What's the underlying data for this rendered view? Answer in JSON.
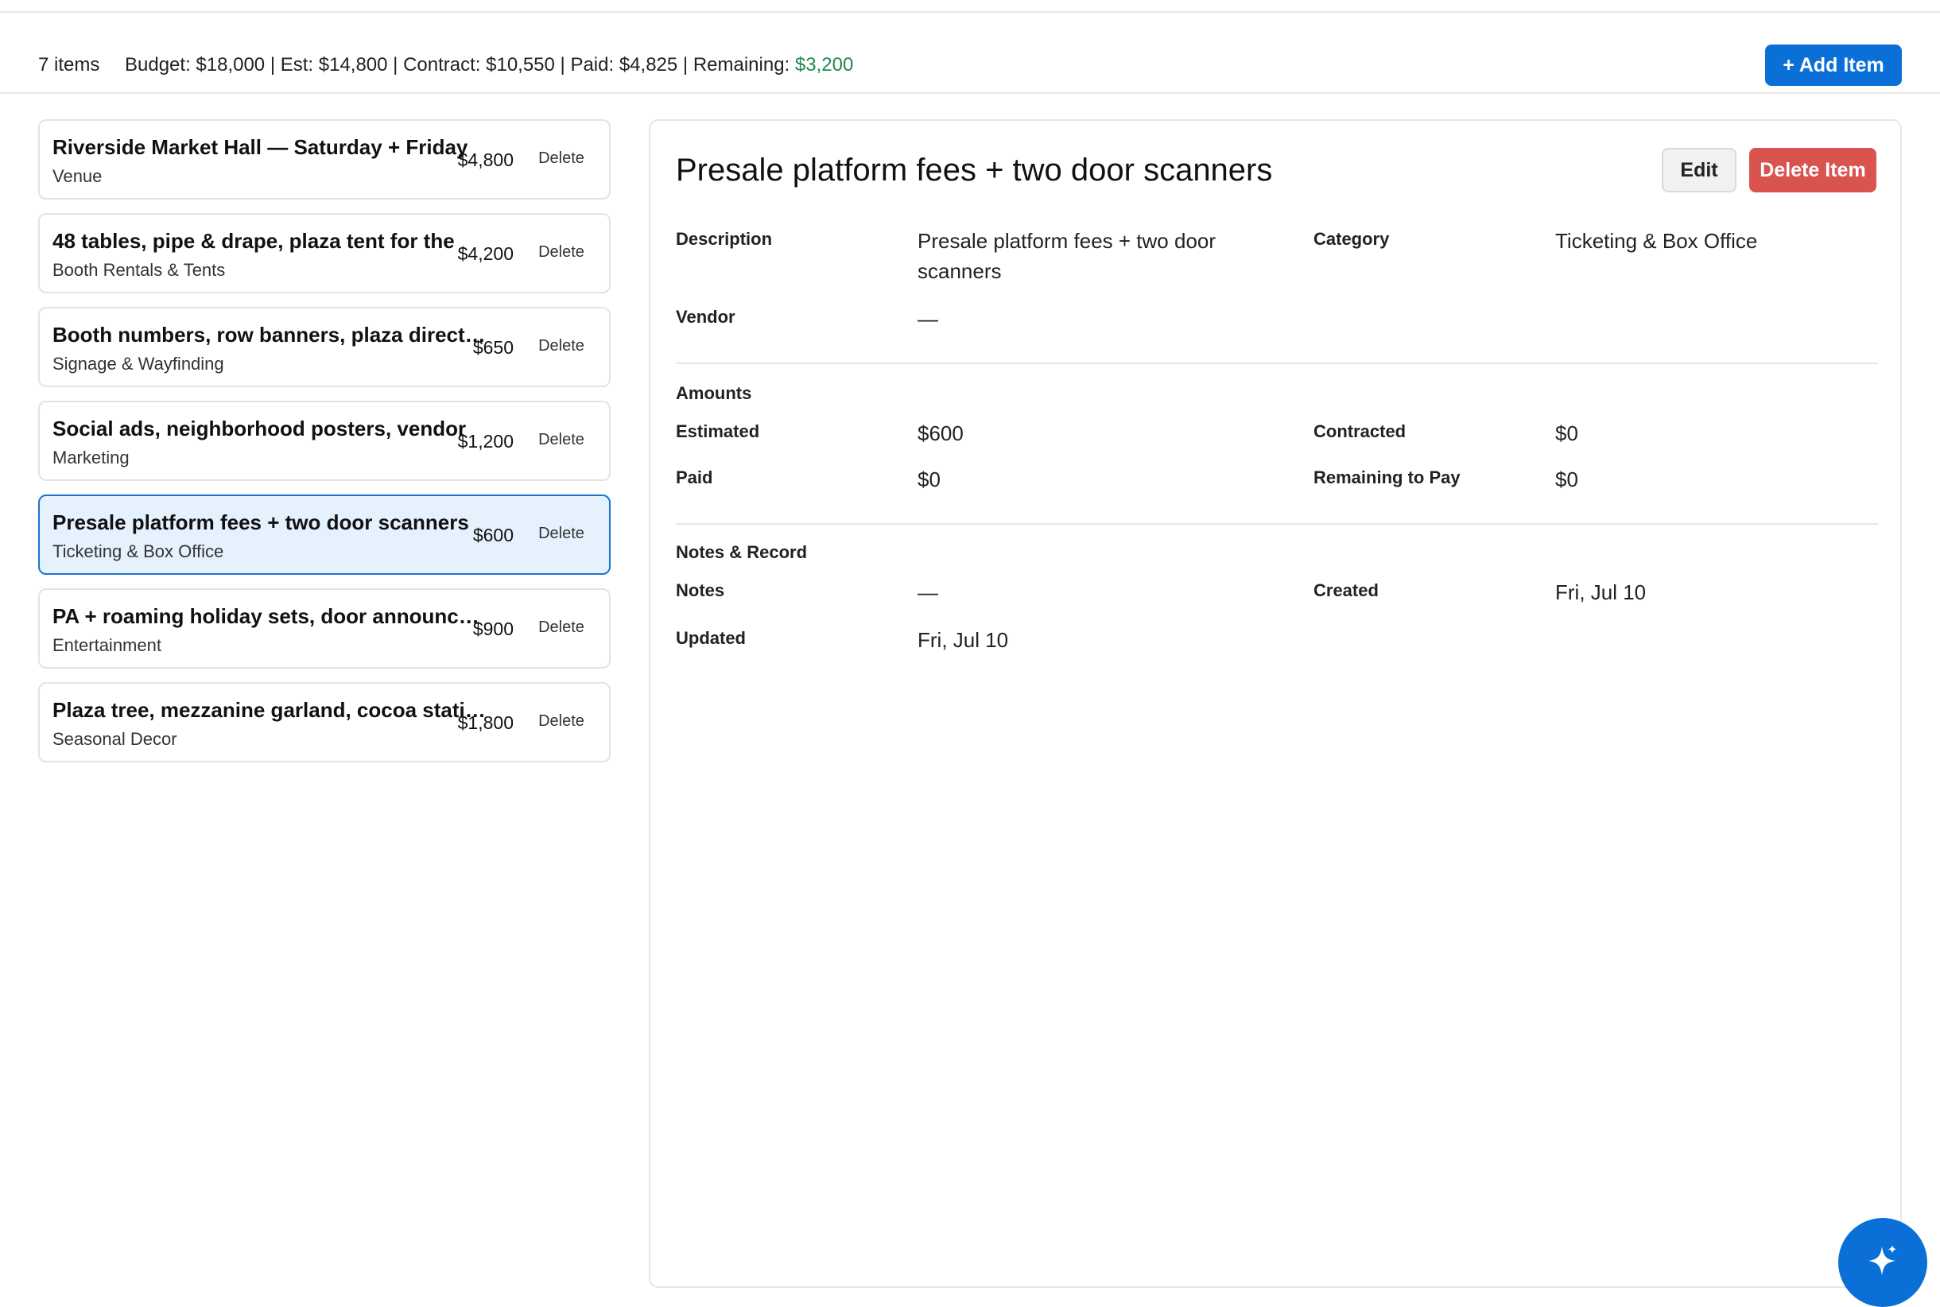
{
  "header": {
    "count": "7 items",
    "budget": "Budget: $18,000",
    "est": "Est: $14,800",
    "contract": "Contract: $10,550",
    "paid": "Paid: $4,825",
    "remaining_label": "Remaining:",
    "remaining_value": "$3,200",
    "separator": " | ",
    "add_button": "+ Add Item"
  },
  "items": [
    {
      "title": "Riverside Market Hall — Saturday + Friday",
      "category": "Venue",
      "amount": "$4,800",
      "delete": "Delete"
    },
    {
      "title": "48 tables, pipe & drape, plaza tent for the",
      "category": "Booth Rentals & Tents",
      "amount": "$4,200",
      "delete": "Delete"
    },
    {
      "title": "Booth numbers, row banners, plaza directional",
      "category": "Signage & Wayfinding",
      "amount": "$650",
      "delete": "Delete"
    },
    {
      "title": "Social ads, neighborhood posters, vendor",
      "category": "Marketing",
      "amount": "$1,200",
      "delete": "Delete"
    },
    {
      "title": "Presale platform fees + two door scanners",
      "category": "Ticketing & Box Office",
      "amount": "$600",
      "delete": "Delete"
    },
    {
      "title": "PA + roaming holiday sets, door announcements",
      "category": "Entertainment",
      "amount": "$900",
      "delete": "Delete"
    },
    {
      "title": "Plaza tree, mezzanine garland, cocoa station",
      "category": "Seasonal Decor",
      "amount": "$1,800",
      "delete": "Delete"
    }
  ],
  "detail": {
    "title": "Presale platform fees + two door scanners",
    "edit_button": "Edit",
    "delete_button": "Delete Item",
    "description_label": "Description",
    "description_value": "Presale platform fees + two door scanners",
    "category_label": "Category",
    "category_value": "Ticketing & Box Office",
    "vendor_label": "Vendor",
    "vendor_value": "—",
    "amounts_heading": "Amounts",
    "estimated_label": "Estimated",
    "estimated_value": "$600",
    "contracted_label": "Contracted",
    "contracted_value": "$0",
    "paid_label": "Paid",
    "paid_value": "$0",
    "remaining_label": "Remaining to Pay",
    "remaining_value": "$0",
    "notes_heading": "Notes & Record",
    "notes_label": "Notes",
    "notes_value": "—",
    "created_label": "Created",
    "created_value": "Fri, Jul 10",
    "updated_label": "Updated",
    "updated_value": "Fri, Jul 10"
  },
  "colors": {
    "accent": "#0b6fd8",
    "danger": "#d9534f",
    "remaining_green": "#1e8a4c",
    "selected_bg": "#e5f1fd"
  },
  "icons": {
    "fab": "sparkle-icon"
  },
  "selected_index": 4
}
